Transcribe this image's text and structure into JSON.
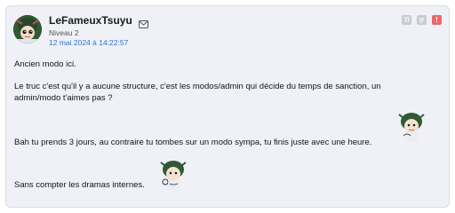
{
  "post": {
    "author": "LeFameuxTsuyu",
    "rank": "Niveau 2",
    "date": "12 mai 2024 à 14:22:57",
    "icons": {
      "message": "envelope-icon",
      "quote": "quote-icon",
      "edit": "edit-icon",
      "alert": "alert-icon"
    },
    "alert_glyph": "!",
    "paragraphs": [
      "Ancien modo ici.",
      "Le truc c'est qu'il y a aucune structure, c'est les modos/admin qui décide du temps de sanction, un admin/modo t'aimes pas ?",
      "Bah tu prends 3 jours, au contraire tu tombes sur un modo sympa, tu finis juste avec une heure.",
      "Sans compter les dramas internes."
    ],
    "colors": {
      "card_bg": "#eff1f6",
      "date_link": "#2f6fd6",
      "alert": "#e86a6a"
    }
  }
}
